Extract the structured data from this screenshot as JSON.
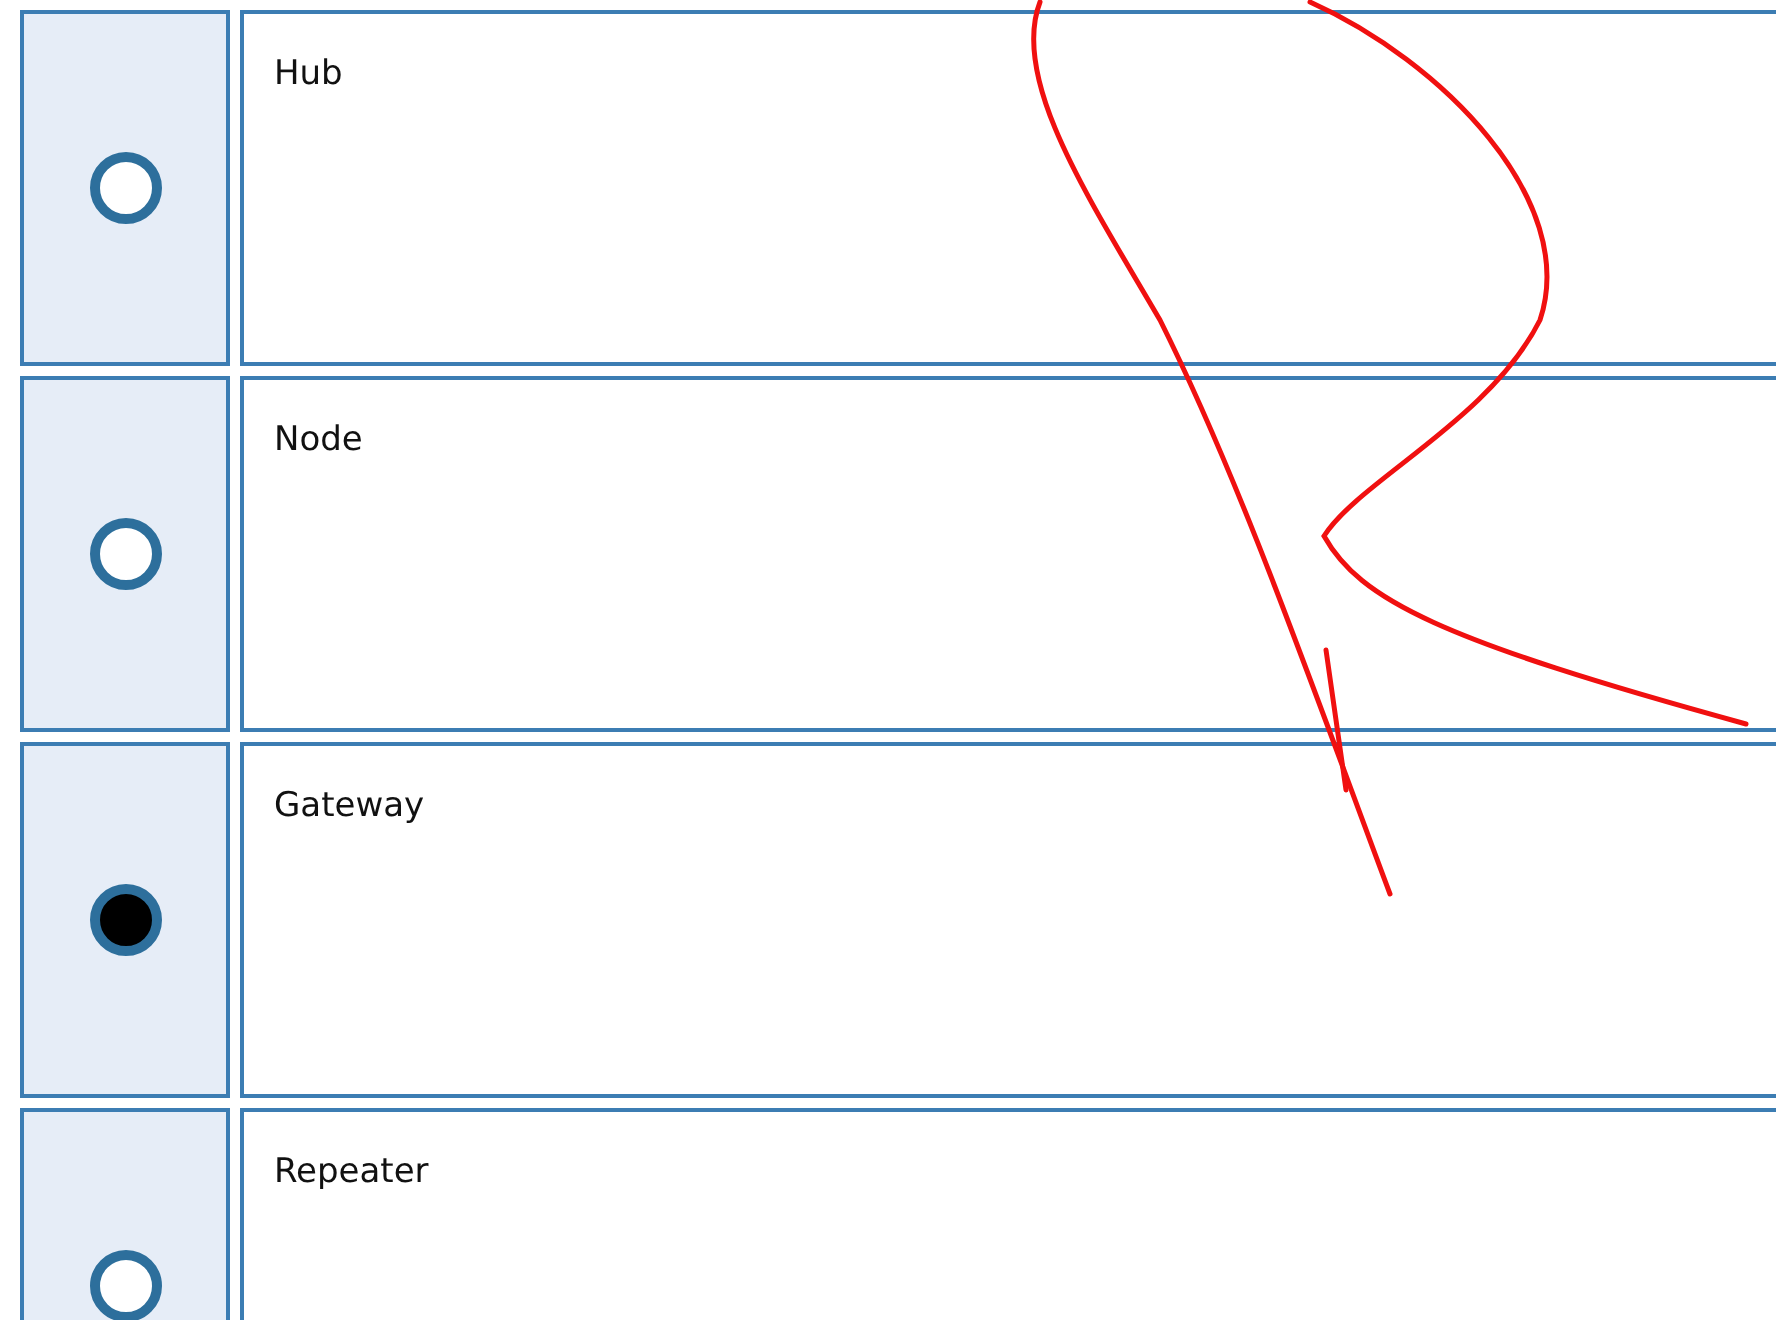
{
  "options": [
    {
      "label": "Hub",
      "selected": false
    },
    {
      "label": "Node",
      "selected": false
    },
    {
      "label": "Gateway",
      "selected": true
    },
    {
      "label": "Repeater",
      "selected": false
    }
  ]
}
